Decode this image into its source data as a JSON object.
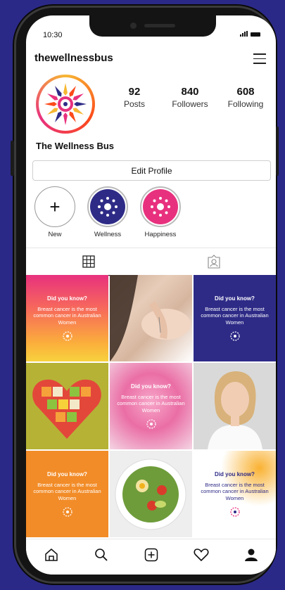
{
  "status_bar": {
    "time": "10:30"
  },
  "profile": {
    "username": "thewellnessbus",
    "display_name": "The Wellness Bus",
    "stats": [
      {
        "num": "92",
        "label": "Posts"
      },
      {
        "num": "840",
        "label": "Followers"
      },
      {
        "num": "608",
        "label": "Following"
      }
    ],
    "edit_label": "Edit Profile"
  },
  "highlights": [
    {
      "label": "New"
    },
    {
      "label": "Wellness",
      "color": "#2e2b87"
    },
    {
      "label": "Happiness",
      "color": "#e8317e"
    }
  ],
  "posts": [
    {
      "kind": "text",
      "title": "Did you know?",
      "body": "Breast cancer is the most common cancer in Australian Women"
    },
    {
      "kind": "photo",
      "subject": "acupuncture"
    },
    {
      "kind": "text",
      "title": "Did you know?",
      "body": "Breast cancer is the most common cancer in Australian Women"
    },
    {
      "kind": "photo",
      "subject": "fruit heart"
    },
    {
      "kind": "text",
      "title": "Did you know?",
      "body": "Breast cancer is the most common cancer in Australian Women"
    },
    {
      "kind": "photo",
      "subject": "smiling woman"
    },
    {
      "kind": "text",
      "title": "Did you know?",
      "body": "Breast cancer is the most common cancer in Australian Women"
    },
    {
      "kind": "photo",
      "subject": "salad bowl"
    },
    {
      "kind": "text",
      "title": "Did you know?",
      "body": "Breast cancer is the most common cancer in Australian Women"
    }
  ],
  "colors": {
    "brand_purple": "#2e2b87",
    "brand_pink": "#e8317e",
    "brand_orange": "#f28c28"
  },
  "icons": [
    "menu-icon",
    "plus-icon",
    "grid-icon",
    "tagged-icon",
    "home-icon",
    "search-icon",
    "add-post-icon",
    "heart-icon",
    "profile-icon"
  ]
}
